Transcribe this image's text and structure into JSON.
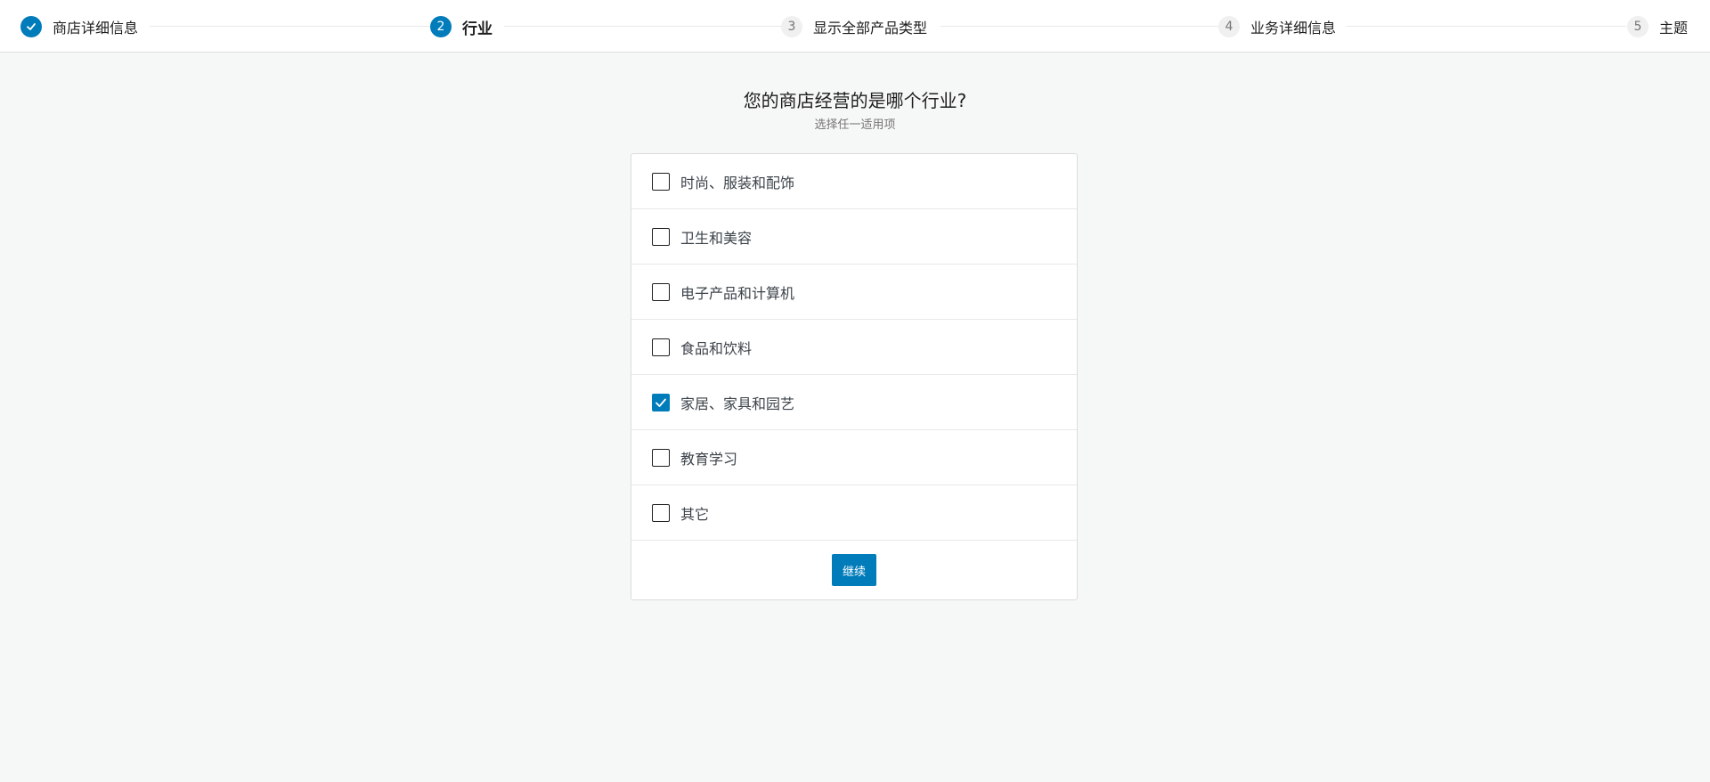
{
  "stepper": {
    "steps": [
      {
        "number": "✓",
        "label": "商店详细信息",
        "state": "done"
      },
      {
        "number": "2",
        "label": "行业",
        "state": "active"
      },
      {
        "number": "3",
        "label": "显示全部产品类型",
        "state": "pending"
      },
      {
        "number": "4",
        "label": "业务详细信息",
        "state": "pending"
      },
      {
        "number": "5",
        "label": "主题",
        "state": "pending"
      }
    ]
  },
  "main": {
    "title": "您的商店经营的是哪个行业?",
    "subtitle": "选择任一适用项",
    "options": [
      {
        "label": "时尚、服装和配饰",
        "checked": false
      },
      {
        "label": "卫生和美容",
        "checked": false
      },
      {
        "label": "电子产品和计算机",
        "checked": false
      },
      {
        "label": "食品和饮料",
        "checked": false
      },
      {
        "label": "家居、家具和园艺",
        "checked": true
      },
      {
        "label": "教育学习",
        "checked": false
      },
      {
        "label": "其它",
        "checked": false
      }
    ],
    "continue_label": "继续"
  },
  "colors": {
    "accent": "#007cba",
    "background": "#f6f7f7",
    "card": "#ffffff"
  }
}
